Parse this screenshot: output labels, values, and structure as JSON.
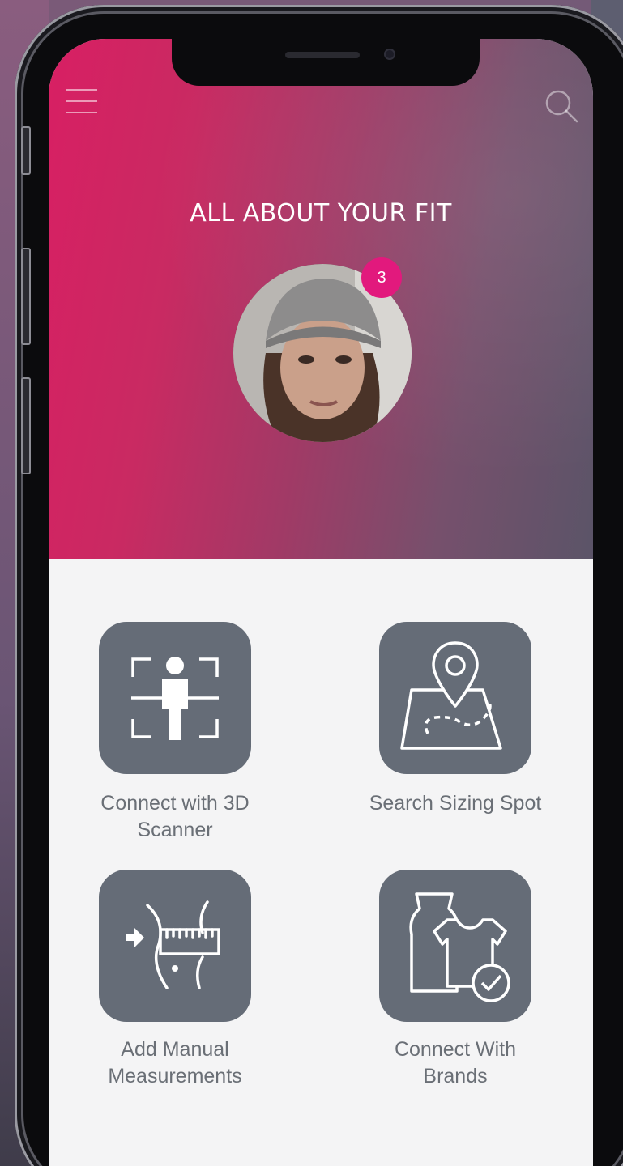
{
  "header": {
    "title": "ALL ABOUT YOUR FIT",
    "notification_count": "3"
  },
  "icons": {
    "menu": "hamburger-menu-icon",
    "search": "search-icon"
  },
  "actions": [
    {
      "label_line1": "Connect with 3D",
      "label_line2": "Scanner",
      "icon": "body-scan-icon"
    },
    {
      "label_line1": "Search Sizing Spot",
      "label_line2": "",
      "icon": "map-pin-icon"
    },
    {
      "label_line1": "Add Manual",
      "label_line2": "Measurements",
      "icon": "measuring-tape-icon"
    },
    {
      "label_line1": "Connect With",
      "label_line2": "Brands",
      "icon": "clothing-check-icon"
    }
  ],
  "colors": {
    "accent": "#d81f63",
    "badge": "#e2197d",
    "tile": "#656c77",
    "label": "#6a6f76"
  }
}
